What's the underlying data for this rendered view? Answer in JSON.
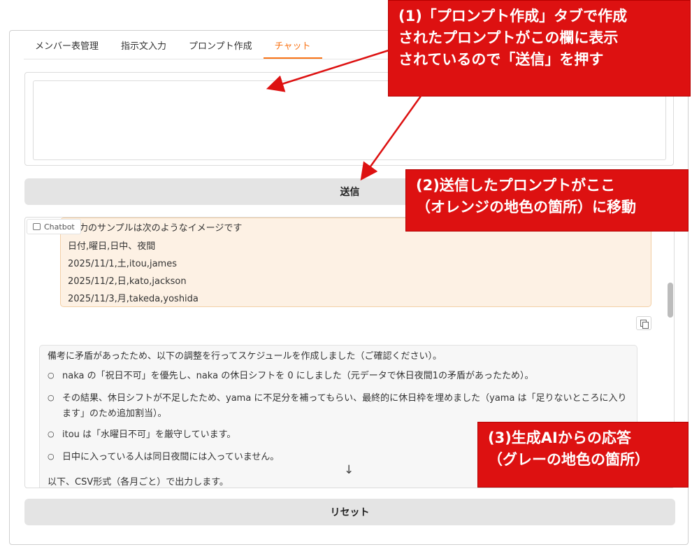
{
  "tabs": [
    {
      "label": "メンバー表管理"
    },
    {
      "label": "指示文入力"
    },
    {
      "label": "プロンプト作成"
    },
    {
      "label": "チャット",
      "active": true
    }
  ],
  "prompt": {
    "value": ""
  },
  "send_button": {
    "label": "送信"
  },
  "chatbot": {
    "label": "Chatbot",
    "user_message_lines": [
      "力のサンプルは次のようなイメージです",
      "日付,曜日,日中、夜間",
      "2025/11/1,土,itou,james",
      "2025/11/2,日,kato,jackson",
      "2025/11/3,月,takeda,yoshida"
    ],
    "bot_message": {
      "intro": "備考に矛盾があったため、以下の調整を行ってスケジュールを作成しました（ご確認ください）。",
      "bullets": [
        "naka の「祝日不可」を優先し、naka の休日シフトを 0 にしました（元データで休日夜間1の矛盾があったため）。",
        "その結果、休日シフトが不足したため、yama に不足分を補ってもらい、最終的に休日枠を埋めました（yama は「足りないところに入ります」のため追加割当）。",
        "itou は「水曜日不可」を厳守しています。",
        "日中に入っている人は同日夜間には入っていません。"
      ],
      "footer": "以下、CSV形式（各月ごと）で出力します。"
    }
  },
  "reset_button": {
    "label": "リセット"
  },
  "callouts": {
    "c1": [
      "(1)「プロンプト作成」タブで作成",
      "されたプロンプトがこの欄に表示",
      "されているので「送信」を押す"
    ],
    "c2": [
      "(2)送信したプロンプトがここ",
      "（オレンジの地色の箇所）に移動"
    ],
    "c3": [
      "(3)生成AIからの応答",
      "（グレーの地色の箇所）"
    ]
  },
  "colors": {
    "accent": "#f97316",
    "callout": "#dd1111",
    "user_bg": "#fdf1e4",
    "bot_bg": "#f7f7f7"
  }
}
